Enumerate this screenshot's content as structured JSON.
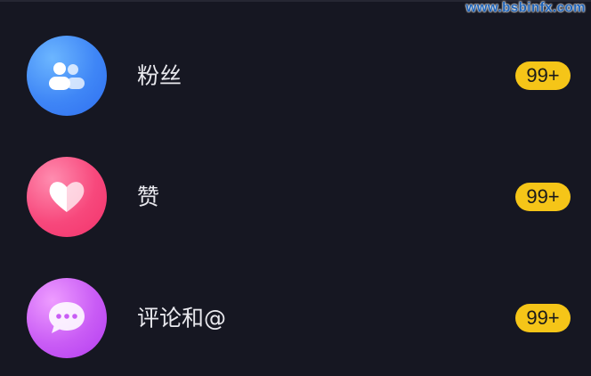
{
  "watermark": "www.bsbinfx.com",
  "notifications": [
    {
      "label": "粉丝",
      "badge": "99+",
      "icon": "fans-icon",
      "colors": [
        "#5aa9ff",
        "#2f6ff0"
      ]
    },
    {
      "label": "赞",
      "badge": "99+",
      "icon": "heart-icon",
      "colors": [
        "#ff7aa0",
        "#f2336b"
      ]
    },
    {
      "label": "评论和@",
      "badge": "99+",
      "icon": "comment-icon",
      "colors": [
        "#e58bff",
        "#b43cf0"
      ]
    }
  ],
  "colors": {
    "background": "#161722",
    "badge": "#f5c518",
    "label": "#e9e9ee"
  }
}
